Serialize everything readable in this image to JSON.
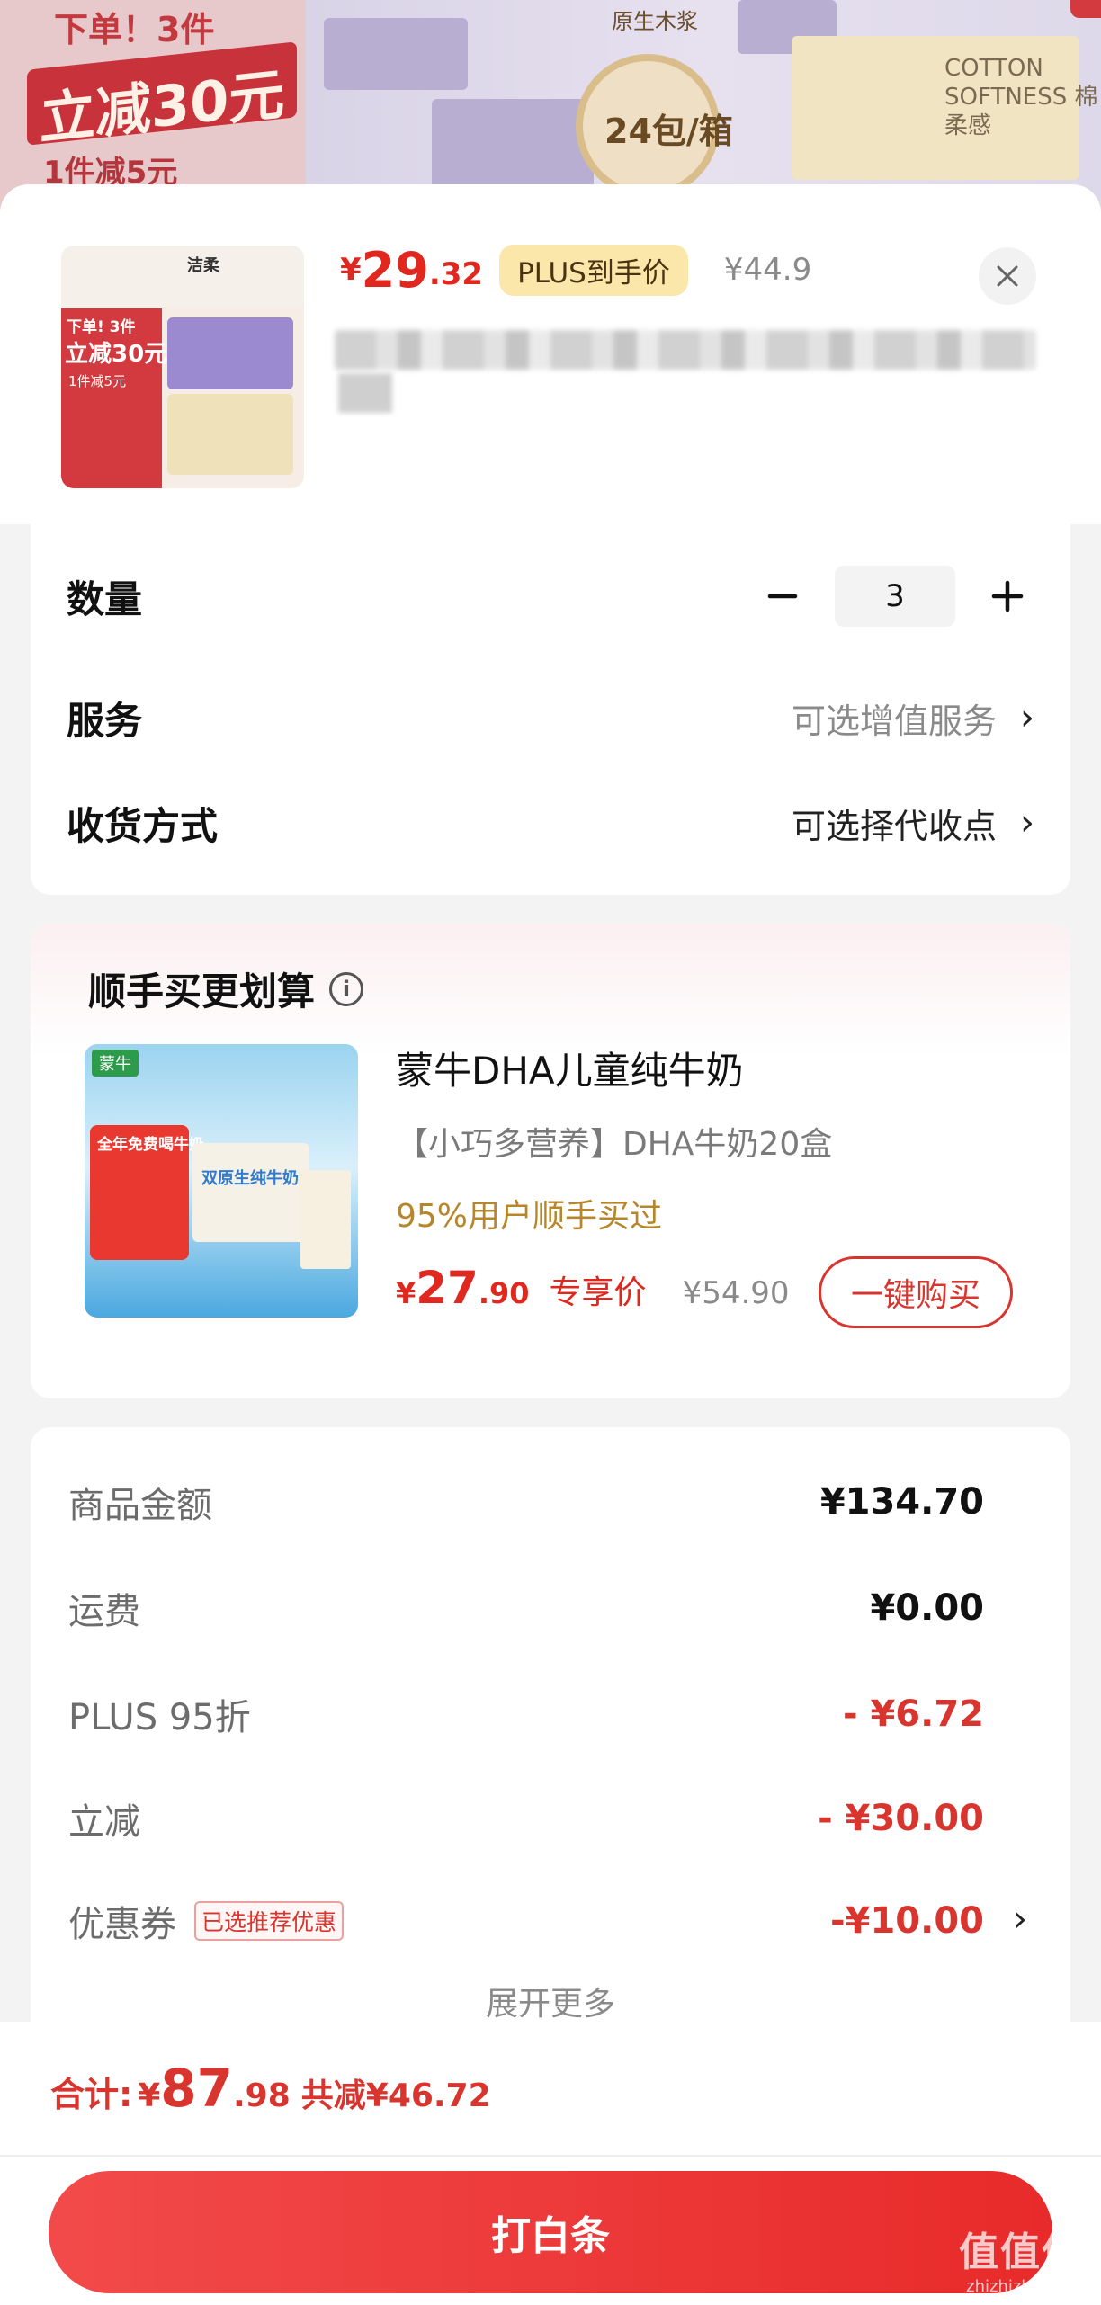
{
  "background": {
    "banner_line1": "下单！3件",
    "banner_big": "立减30元",
    "banner_line2": "1件减5元",
    "label_pulp": "原生木浆",
    "badge_packs": "24包/箱",
    "package_text": "COTTON SOFTNESS 棉柔感"
  },
  "product": {
    "thumb_top_logo": "洁柔",
    "thumb_line1": "下单! 3件",
    "thumb_big": "立减30元",
    "thumb_line2": "1件减5元",
    "currency": "¥",
    "price_int": "29",
    "price_dec": ".32",
    "plus_tag": "PLUS到手价",
    "original_price": "¥44.9"
  },
  "options": {
    "quantity_label": "数量",
    "quantity_value": "3",
    "service_label": "服务",
    "service_value": "可选增值服务",
    "delivery_label": "收货方式",
    "delivery_value": "可选择代收点"
  },
  "recommend": {
    "title": "顺手买更划算",
    "image_logo": "蒙牛",
    "image_red_text": "全年免费喝牛奶",
    "image_box_text": "双原生纯牛奶",
    "name": "蒙牛DHA儿童纯牛奶",
    "desc": "【小巧多营养】DHA牛奶20盒",
    "stat": "95%用户顺手买过",
    "currency": "¥",
    "price_int": "27",
    "price_dec": ".90",
    "price_tag": "专享价",
    "orig_price": "¥54.90",
    "buy_label": "一键购买"
  },
  "summary": {
    "rows": [
      {
        "label": "商品金额",
        "value": "¥134.70"
      },
      {
        "label": "运费",
        "value": "¥0.00"
      },
      {
        "label": "PLUS 95折",
        "value": "- ¥6.72"
      },
      {
        "label": "立减",
        "value": "- ¥30.00"
      },
      {
        "label": "优惠券",
        "value": "-¥10.00"
      }
    ],
    "coupon_tag": "已选推荐优惠",
    "expand_label": "展开更多"
  },
  "footer": {
    "total_label": "合计:",
    "currency": "¥",
    "total_int": "87",
    "total_dec": ".98",
    "saved": "共减¥46.72",
    "pay_button": "打白条"
  },
  "watermark": {
    "big": "值值值",
    "small": "zhizhizhi.com"
  },
  "colors": {
    "accent_red": "#e0281f",
    "plus_gold": "#fbe7a9",
    "stat_gold": "#b8862a"
  }
}
